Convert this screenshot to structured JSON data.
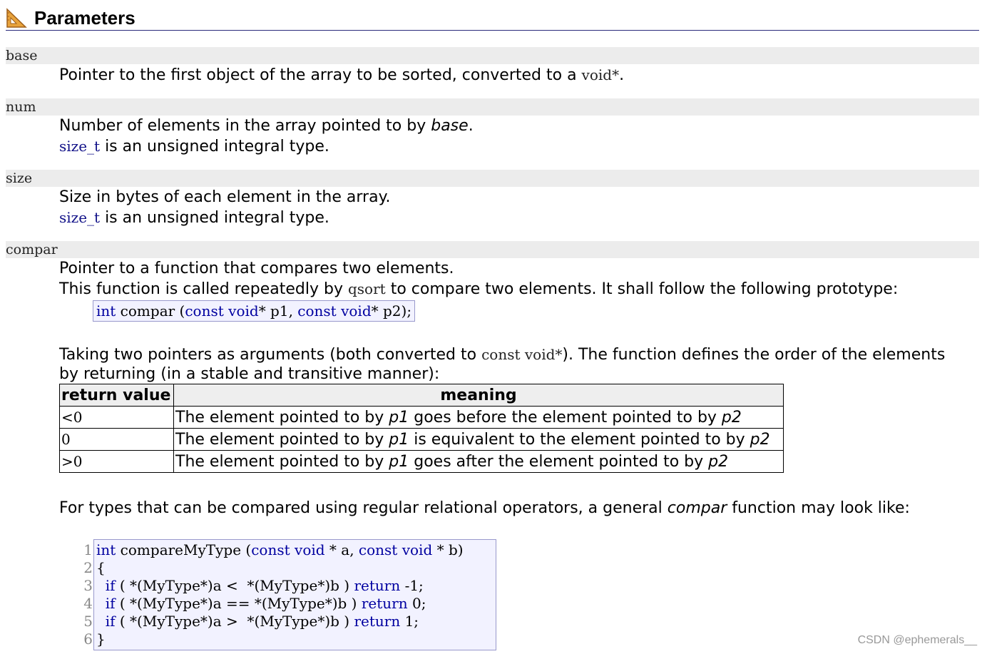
{
  "header": {
    "title": "Parameters",
    "icon": "ruler-triangle-icon"
  },
  "params": [
    {
      "name": "base",
      "line1_a": "Pointer to the first object of the array to be sorted, converted to a ",
      "line1_code": "void*",
      "line1_b": "."
    },
    {
      "name": "num",
      "line1_a": "Number of elements in the array pointed to by ",
      "line1_em": "base",
      "line1_b": ".",
      "line2_code": "size_t",
      "line2_text": " is an unsigned integral type."
    },
    {
      "name": "size",
      "line1": "Size in bytes of each element in the array.",
      "line2_code": "size_t",
      "line2_text": " is an unsigned integral type."
    },
    {
      "name": "compar",
      "line1": "Pointer to a function that compares two elements.",
      "line2_a": "This function is called repeatedly by ",
      "line2_code": "qsort",
      "line2_b": " to compare two elements. It shall follow the following prototype:",
      "prototype": {
        "t1": "int",
        "t2": " compar ",
        "t3": "(",
        "t4": "const void",
        "t5": "* p1, ",
        "t6": "const void",
        "t7": "* p2);"
      },
      "para_a": "Taking two pointers as arguments (both converted to ",
      "para_code": "const void*",
      "para_b": "). The function defines the order of the elements",
      "para_line2": "by returning (in a stable and transitive manner):",
      "closing_a": "For types that can be compared using regular relational operators, a general ",
      "closing_em": "compar",
      "closing_b": " function may look like:"
    }
  ],
  "table": {
    "headers": [
      "return value",
      "meaning"
    ],
    "rows": [
      {
        "value": "<0",
        "m1": "The element pointed to by ",
        "p1": "p1",
        "m2": " goes before the element pointed to by ",
        "p2": "p2"
      },
      {
        "value": "0",
        "m1": "The element pointed to by ",
        "p1": "p1",
        "m2": " is equivalent to the element pointed to by ",
        "p2": "p2"
      },
      {
        "value": ">0",
        "m1": "The element pointed to by ",
        "p1": "p1",
        "m2": " goes after the element pointed to by ",
        "p2": "p2"
      }
    ]
  },
  "code": {
    "line_numbers": [
      "1",
      "2",
      "3",
      "4",
      "5",
      "6"
    ],
    "lines": [
      [
        {
          "t": "int",
          "k": 1
        },
        {
          "t": " compareMyType (",
          "k": 0
        },
        {
          "t": "const void",
          "k": 1
        },
        {
          "t": " * a, ",
          "k": 0
        },
        {
          "t": "const void",
          "k": 1
        },
        {
          "t": " * b)",
          "k": 0
        }
      ],
      [
        {
          "t": "{",
          "k": 0
        }
      ],
      [
        {
          "t": "  ",
          "k": 0
        },
        {
          "t": "if",
          "k": 1
        },
        {
          "t": " ( *(MyType*)a <  *(MyType*)b ) ",
          "k": 0
        },
        {
          "t": "return",
          "k": 1
        },
        {
          "t": " -1;",
          "k": 0
        }
      ],
      [
        {
          "t": "  ",
          "k": 0
        },
        {
          "t": "if",
          "k": 1
        },
        {
          "t": " ( *(MyType*)a == *(MyType*)b ) ",
          "k": 0
        },
        {
          "t": "return",
          "k": 1
        },
        {
          "t": " 0;",
          "k": 0
        }
      ],
      [
        {
          "t": "  ",
          "k": 0
        },
        {
          "t": "if",
          "k": 1
        },
        {
          "t": " ( *(MyType*)a >  *(MyType*)b ) ",
          "k": 0
        },
        {
          "t": "return",
          "k": 1
        },
        {
          "t": " 1;",
          "k": 0
        }
      ],
      [
        {
          "t": "}",
          "k": 0
        }
      ]
    ]
  },
  "watermark": "CSDN @ephemerals__",
  "colors": {
    "keyword": "#0000a0",
    "code_bg": "#f2f2ff",
    "param_bar": "#ececec"
  }
}
